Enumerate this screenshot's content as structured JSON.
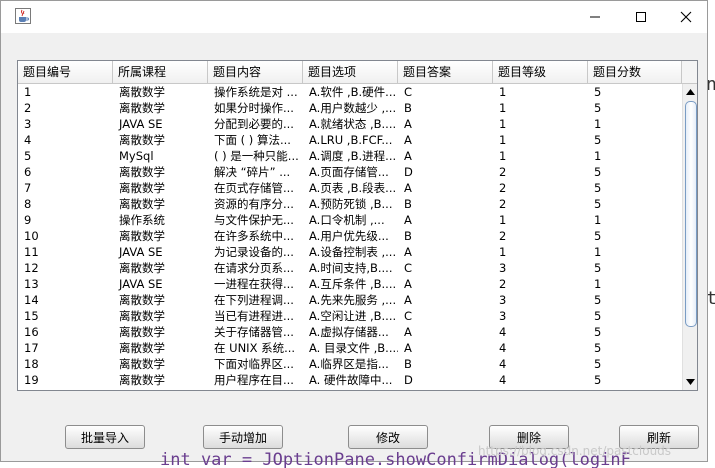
{
  "window": {
    "title": ""
  },
  "table": {
    "headers": [
      "题目编号",
      "所属课程",
      "题目内容",
      "题目选项",
      "题目答案",
      "题目等级",
      "题目分数"
    ],
    "rows": [
      [
        "1",
        "离散数学",
        "操作系统是对 ...",
        "A.软件 ,B.硬件...",
        "C",
        "1",
        "5"
      ],
      [
        "2",
        "离散数学",
        "如果分时操作...",
        "A.用户数越少 ,...",
        "B",
        "1",
        "5"
      ],
      [
        "3",
        "JAVA SE",
        "分配到必要的...",
        "A.就绪状态 ,B....",
        "A",
        "1",
        "1"
      ],
      [
        "4",
        "离散数学",
        "下面 ( ) 算法...",
        "A.LRU ,B.FCF...",
        "A",
        "1",
        "5"
      ],
      [
        "5",
        "MySql",
        "( ) 是一种只能...",
        "A.调度 ,B.进程...",
        "A",
        "1",
        "1"
      ],
      [
        "6",
        "离散数学",
        "解决 “碎片” ...",
        "A.页面存储管...",
        "D",
        "2",
        "5"
      ],
      [
        "7",
        "离散数学",
        "在页式存储管...",
        "A.页表 ,B.段表...",
        "A",
        "2",
        "5"
      ],
      [
        "8",
        "离散数学",
        "资源的有序分...",
        "A.预防死锁 ,B...",
        "B",
        "2",
        "5"
      ],
      [
        "9",
        "操作系统",
        "与文件保护无...",
        "A.口令机制   ,...",
        "A",
        "1",
        "1"
      ],
      [
        "10",
        "离散数学",
        " 在许多系统中...",
        "A.用户优先级...",
        "B",
        "2",
        "5"
      ],
      [
        "11",
        "JAVA SE",
        " 为记录设备的...",
        "A.设备控制表 ,...",
        "A",
        "1",
        "1"
      ],
      [
        "12",
        "离散数学",
        "在请求分页系...",
        "A.时间支持,B....",
        "C",
        "3",
        "5"
      ],
      [
        "13",
        "JAVA SE",
        "一进程在获得...",
        "A.互斥条件 ,B....",
        "A",
        "2",
        "1"
      ],
      [
        "14",
        "离散数学",
        "在下列进程调...",
        "A.先来先服务 ,...",
        "A",
        "3",
        "5"
      ],
      [
        "15",
        "离散数学",
        "当已有进程进...",
        "A.空闲让进 ,B....",
        "C",
        "3",
        "5"
      ],
      [
        "16",
        "离散数学",
        "关于存储器管...",
        "A.虚拟存储器...",
        "A",
        "4",
        "5"
      ],
      [
        "17",
        "离散数学",
        "在 UNIX 系统...",
        "A. 目录文件 ,B....",
        "A",
        "4",
        "5"
      ],
      [
        "18",
        "离散数学",
        "下面对临界区...",
        "A.临界区是指...",
        "B",
        "4",
        "5"
      ],
      [
        "19",
        "离散数学",
        "用户程序在目...",
        "A. 硬件故障中...",
        "D",
        "4",
        "5"
      ]
    ]
  },
  "buttons": {
    "import": "批量导入",
    "add": "手动增加",
    "edit": "修改",
    "delete": "删除",
    "refresh": "刷新"
  },
  "watermark": "https://blog.csdn.net/pastclouds",
  "icons": {
    "app": "java-cup-icon",
    "minimize": "minimize-icon",
    "maximize": "maximize-icon",
    "close": "close-icon"
  }
}
